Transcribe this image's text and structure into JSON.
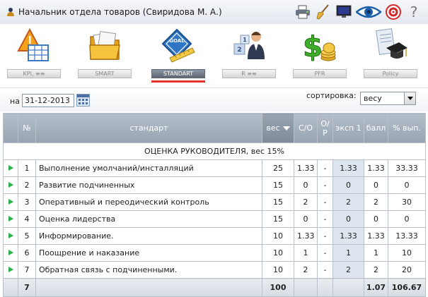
{
  "header": {
    "user_title": "Начальник отдела товаров  (Свиридова М. А.)",
    "tools": [
      "printer-icon",
      "broom-icon",
      "monitor-icon",
      "eye-icon",
      "target-icon",
      "help-icon"
    ],
    "help_glyph": "?"
  },
  "nav": {
    "active": "STANDART",
    "items": [
      {
        "label": "KPI, ≡≡",
        "icon": "warning-grid-icon"
      },
      {
        "label": "SMART",
        "icon": "folder-icon"
      },
      {
        "label": "STANDART",
        "icon": "goal-ruler-icon"
      },
      {
        "label": "R  ≡≡",
        "icon": "person-cubes-icon"
      },
      {
        "label": "PFR",
        "icon": "dollar-coins-icon"
      },
      {
        "label": "Policy",
        "icon": "diploma-cap-icon"
      }
    ]
  },
  "filter": {
    "date_label": "на",
    "date_value": "31-12-2013",
    "sort_label": "сортировка:",
    "sort_value": "весу"
  },
  "table": {
    "headers": {
      "num": "№",
      "standard": "стандарт",
      "weight": "вес",
      "so": "С/О",
      "op": "О/\nР",
      "exp1": "эксп 1",
      "score": "балл",
      "percent": "% вып."
    },
    "section": "ОЦЕНКА РУКОВОДИТЕЛЯ, вес 15%",
    "rows": [
      {
        "num": "1",
        "name": "Выполнение умолчаний/инсталляций",
        "weight": "25",
        "so": "1.33",
        "op": "-",
        "exp1": "1.33",
        "score": "1.33",
        "percent": "33.33"
      },
      {
        "num": "2",
        "name": "Развитие подчиненных",
        "weight": "15",
        "so": "0",
        "op": "-",
        "exp1": "0",
        "score": "0",
        "percent": "0"
      },
      {
        "num": "3",
        "name": "Оперативный и переодический контроль",
        "weight": "15",
        "so": "2",
        "op": "-",
        "exp1": "2",
        "score": "2",
        "percent": "30"
      },
      {
        "num": "4",
        "name": "Оценка лидерства",
        "weight": "15",
        "so": "0",
        "op": "-",
        "exp1": "0",
        "score": "0",
        "percent": "0"
      },
      {
        "num": "5",
        "name": "Информирование.",
        "weight": "10",
        "so": "1.33",
        "op": "-",
        "exp1": "1.33",
        "score": "1.33",
        "percent": "13.33"
      },
      {
        "num": "6",
        "name": "Поощрение и наказание",
        "weight": "10",
        "so": "1",
        "op": "-",
        "exp1": "1",
        "score": "1",
        "percent": "10"
      },
      {
        "num": "7",
        "name": "Обратная связь с подчиненными.",
        "weight": "10",
        "so": "2",
        "op": "-",
        "exp1": "2",
        "score": "2",
        "percent": "20"
      }
    ],
    "totals": {
      "count": "7",
      "weight": "100",
      "score": "1.07",
      "percent": "106.67"
    }
  },
  "colors": {
    "accent": "#e3332a",
    "header": "#a7b2bf",
    "play": "#2bb34a"
  }
}
